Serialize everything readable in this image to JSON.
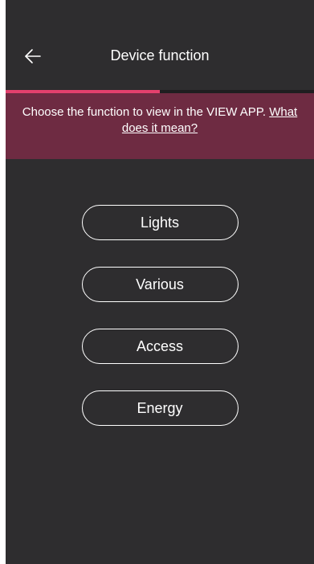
{
  "header": {
    "title": "Device function",
    "back_icon": "arrow-left-icon"
  },
  "progress": {
    "fraction": 0.5,
    "color": "#e4406d"
  },
  "banner": {
    "text": "Choose the function to view in the VIEW APP.",
    "link": "What does it mean?",
    "color": "#6e2b42"
  },
  "options": [
    {
      "label": "Lights"
    },
    {
      "label": "Various"
    },
    {
      "label": "Access"
    },
    {
      "label": "Energy"
    }
  ],
  "colors": {
    "background": "#2e2d2f",
    "accent": "#e4406d"
  }
}
